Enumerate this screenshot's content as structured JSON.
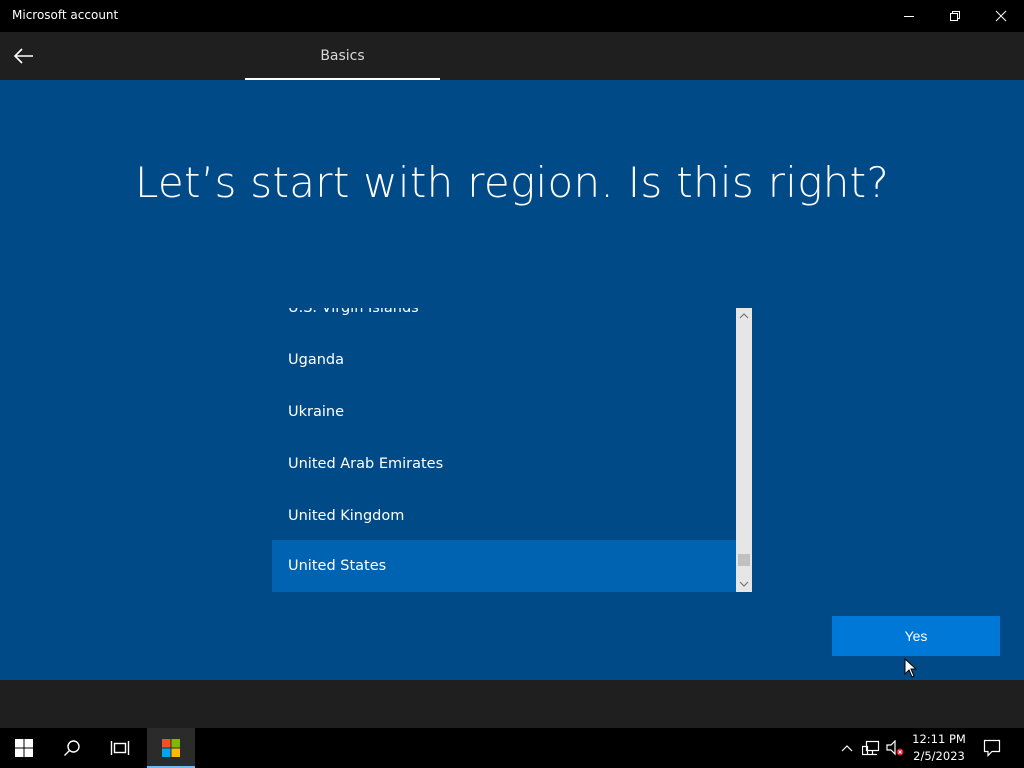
{
  "window": {
    "title": "Microsoft account"
  },
  "nav": {
    "tab_label": "Basics"
  },
  "main": {
    "heading": "Let’s start with region. Is this right?",
    "regions": [
      {
        "label": "U.S. Virgin Islands",
        "selected": false
      },
      {
        "label": "Uganda",
        "selected": false
      },
      {
        "label": "Ukraine",
        "selected": false
      },
      {
        "label": "United Arab Emirates",
        "selected": false
      },
      {
        "label": "United Kingdom",
        "selected": false
      },
      {
        "label": "United States",
        "selected": true
      }
    ],
    "yes_label": "Yes"
  },
  "taskbar": {
    "time": "12:11 PM",
    "date": "2/5/2023"
  },
  "colors": {
    "background": "#004b87",
    "selected_item": "#0063b1",
    "accent_button": "#0078d7"
  },
  "icons": {
    "minimize": "minimize-icon",
    "restore": "restore-icon",
    "close": "close-icon",
    "back": "back-arrow-icon",
    "start": "windows-logo-icon",
    "search": "search-icon",
    "task_view": "task-view-icon",
    "app": "microsoft-store-icon",
    "chevron_up": "chevron-up-icon",
    "network": "network-icon",
    "volume": "volume-muted-icon",
    "notifications": "action-center-icon"
  }
}
